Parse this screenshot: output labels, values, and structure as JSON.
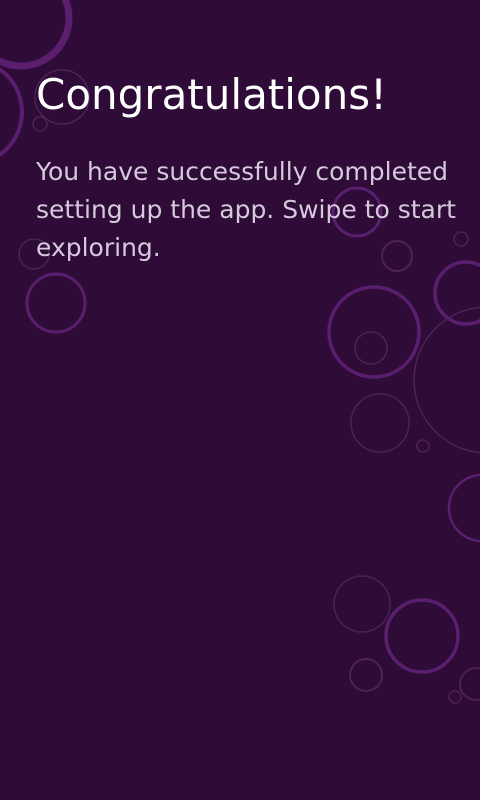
{
  "screen": {
    "background_color": "#2e0c37",
    "decoration": "bubble-circles",
    "circle_stroke_bright": "#5a1e6e",
    "circle_stroke_faint": "#4d2256"
  },
  "content": {
    "title": "Congratulations!",
    "message": "You have successfully completed setting up the app. Swipe to start exploring."
  }
}
